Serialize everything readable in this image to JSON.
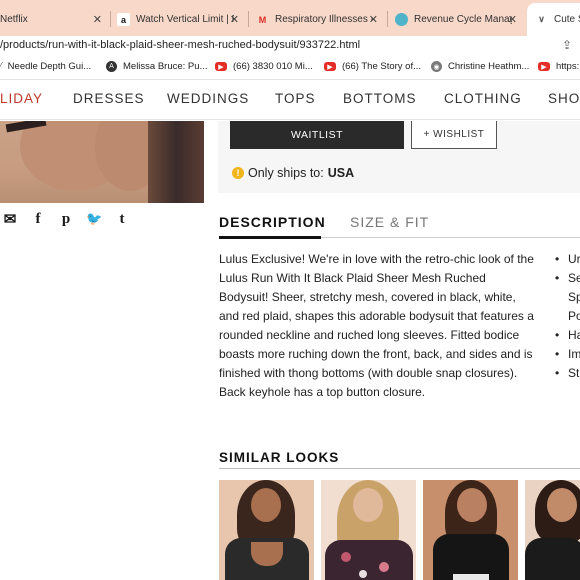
{
  "browser": {
    "tabs": [
      {
        "title": "Netflix",
        "favicon": "netflix-icon",
        "active": false
      },
      {
        "title": "Watch Vertical Limit | Prime",
        "favicon": "amazon-icon",
        "active": false
      },
      {
        "title": "Respiratory Illnesses -",
        "favicon": "gmail-icon",
        "active": false
      },
      {
        "title": "Revenue Cycle Manag",
        "favicon": "globe-icon",
        "active": false
      },
      {
        "title": "Cute S",
        "favicon": "lulus-icon",
        "active": true
      }
    ],
    "url": "/products/run-with-it-black-plaid-sheer-mesh-ruched-bodysuit/933722.html",
    "bookmarks": [
      {
        "label": "Needle Depth Gui...",
        "icon": "feather-icon"
      },
      {
        "label": "Melissa Bruce: Pu...",
        "icon": "a-icon"
      },
      {
        "label": "(66) 3830 010 Mi...",
        "icon": "youtube-icon"
      },
      {
        "label": "(66) The Story of...",
        "icon": "youtube-icon"
      },
      {
        "label": "Christine Heathm...",
        "icon": "globe-icon"
      },
      {
        "label": "https:",
        "icon": "youtube-icon"
      }
    ]
  },
  "site_nav": {
    "items": [
      "LIDAY",
      "DRESSES",
      "WEDDINGS",
      "TOPS",
      "BOTTOMS",
      "CLOTHING",
      "SHO"
    ]
  },
  "purchase": {
    "waitlist_label": "WAITLIST",
    "wishlist_label": "+ WISHLIST",
    "ships_label": "Only ships to:",
    "ships_country": "USA"
  },
  "share_icons": [
    "email-icon",
    "facebook-icon",
    "pinterest-icon",
    "twitter-icon",
    "tumblr-icon"
  ],
  "product_tabs": {
    "description": "DESCRIPTION",
    "size_fit": "SIZE & FIT"
  },
  "description_text": "Lulus Exclusive! We're in love with the retro-chic look of the Lulus Run With It Black Plaid Sheer Mesh Ruched Bodysuit! Sheer, stretchy mesh, covered in black, white, and red plaid, shapes this adorable bodysuit that features a rounded neckline and ruched long sleeves. Fitted bodice boasts more ruching down the front, back, and sides and is finished with thong bottoms (with double snap closures). Back keyhole has a top button closure.",
  "bullets": [
    "Ur",
    "Se",
    "Sp",
    "Po",
    "Ha",
    "Im",
    "St"
  ],
  "similar": {
    "title": "SIMILAR LOOKS"
  }
}
